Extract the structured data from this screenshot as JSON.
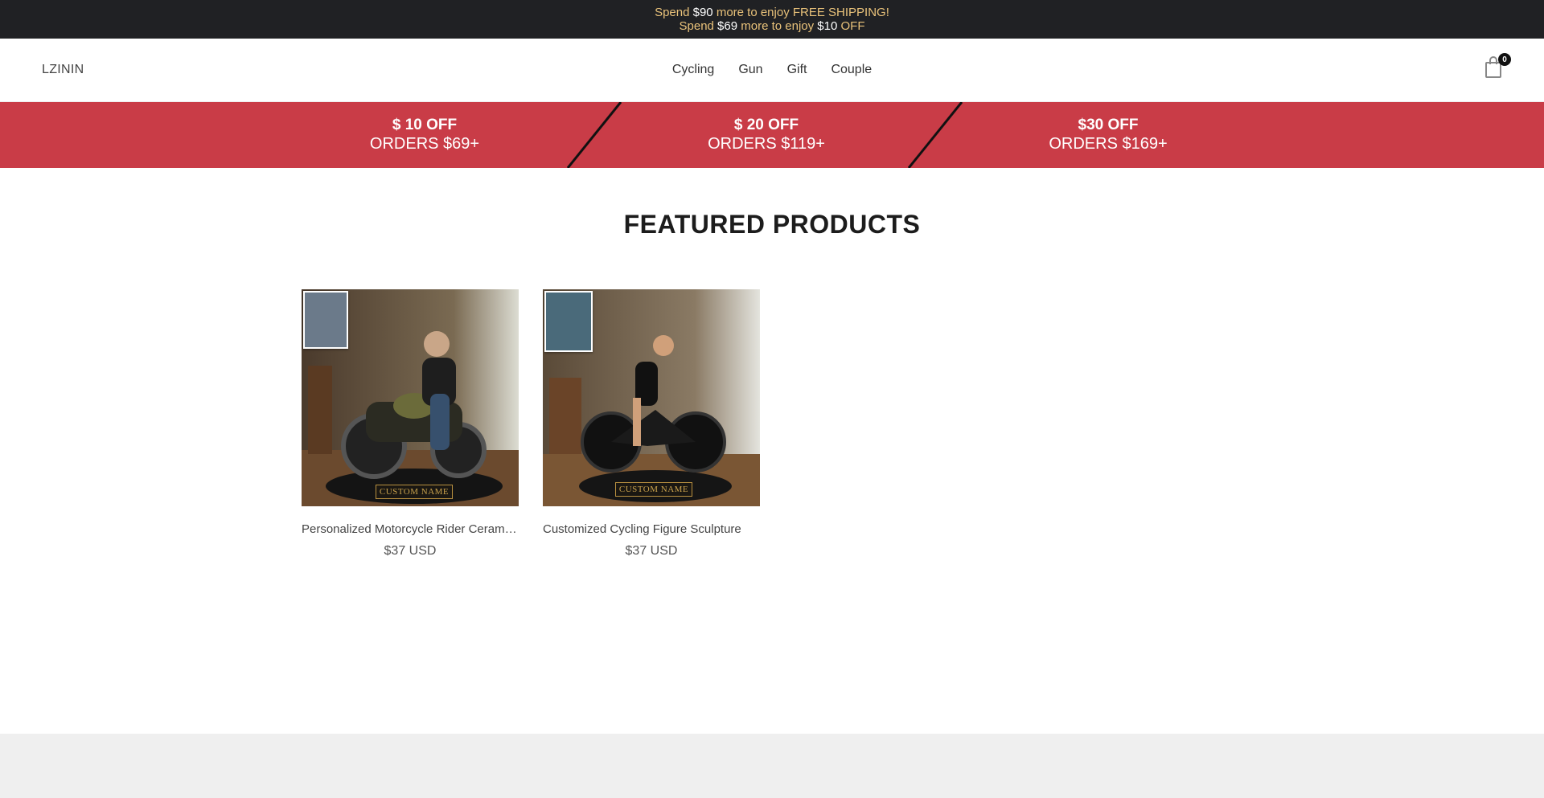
{
  "announcement": {
    "line1": {
      "pre": "Spend ",
      "amount": "$90",
      "post": " more to enjoy FREE SHIPPING!"
    },
    "line2": {
      "pre": "Spend ",
      "amount": "$69",
      "mid": " more to enjoy ",
      "discount": "$10",
      "post": " OFF"
    }
  },
  "header": {
    "logo": "LZININ",
    "menu": [
      "Cycling",
      "Gun",
      "Gift",
      "Couple"
    ],
    "cart_count": "0",
    "cart_icon": "shopping-bag-icon"
  },
  "promo": [
    {
      "title": "$ 10 OFF",
      "subtitle": "ORDERS $69+"
    },
    {
      "title": "$ 20 OFF",
      "subtitle": "ORDERS $119+"
    },
    {
      "title": "$30 OFF",
      "subtitle": "ORDERS $169+"
    }
  ],
  "featured": {
    "heading": "FEATURED PRODUCTS",
    "products": [
      {
        "name": "Personalized Motorcycle Rider Ceramic Figure Sculpture",
        "price": "$37 USD",
        "plaque": "CUSTOM NAME"
      },
      {
        "name": "Customized Cycling Figure Sculpture",
        "price": "$37 USD",
        "plaque": "CUSTOM NAME"
      }
    ]
  },
  "colors": {
    "announce_bg": "#202124",
    "announce_text": "#e9c27a",
    "promo_bg": "#c93c47",
    "footer_bg": "#efefef"
  }
}
